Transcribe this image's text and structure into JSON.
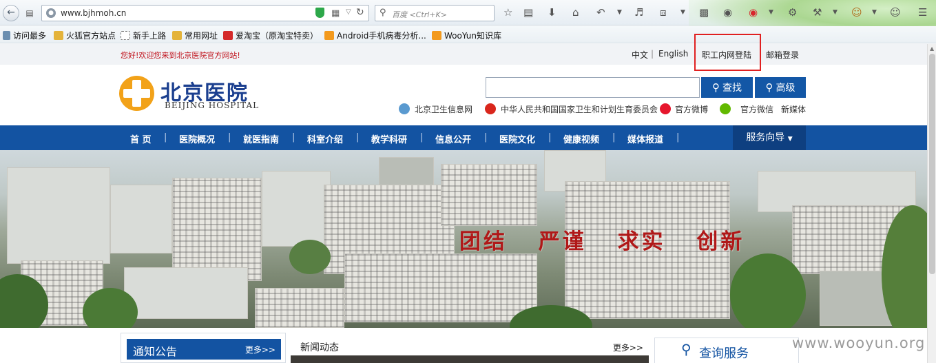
{
  "browser": {
    "url": "www.bjhmoh.cn",
    "search_placeholder": "百度 <Ctrl+K>"
  },
  "bookmarks": [
    {
      "label": "访问最多",
      "color": "#6b8fb0"
    },
    {
      "label": "火狐官方站点",
      "color": "#e4b33a"
    },
    {
      "label": "新手上路",
      "color": "#ffffff"
    },
    {
      "label": "常用网址",
      "color": "#e4b33a"
    },
    {
      "label": "爱淘宝（原淘宝特卖）",
      "color": "#d42a2a"
    },
    {
      "label": "Android手机病毒分析...",
      "color": "#f39a1d"
    },
    {
      "label": "WooYun知识库",
      "color": "#f39a1d"
    }
  ],
  "site": {
    "welcome": "您好!欢迎您来到北京医院官方网站!",
    "top_links": {
      "lang_cn": "中文",
      "lang_en": "English",
      "staff_login": "职工内网登陆",
      "mail_login": "邮箱登录"
    },
    "logo": {
      "cn": "北京医院",
      "en": "BEIJING HOSPITAL"
    },
    "search": {
      "search_btn": "查找",
      "advanced_btn": "高级"
    },
    "quick_links": {
      "bj_health": "北京卫生信息网",
      "nhfpc": "中华人民共和国国家卫生和计划生育委员会",
      "weibo": "官方微博",
      "wechat": "官方微信",
      "new_media": "新媒体"
    },
    "nav": [
      "首 页",
      "医院概况",
      "就医指南",
      "科室介绍",
      "教学科研",
      "信息公开",
      "医院文化",
      "健康视频",
      "媒体报道"
    ],
    "nav_service": "服务向导",
    "slogan": "团结 严谨 求实 创新",
    "notice": {
      "title": "通知公告",
      "more": "更多>>"
    },
    "news": {
      "title": "新闻动态",
      "more": "更多>>"
    },
    "query": {
      "title": "查询服务"
    },
    "watermark": "www.wooyun.org"
  },
  "colors": {
    "brand_blue": "#1353a2",
    "login_highlight": "#e02020",
    "slogan_red": "#b01818"
  }
}
